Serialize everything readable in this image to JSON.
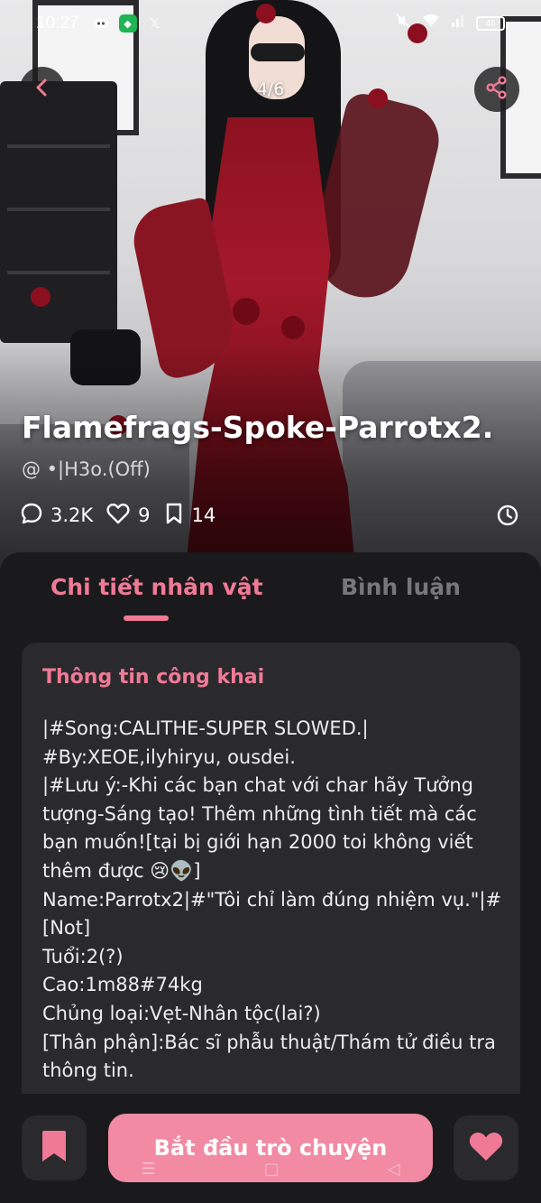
{
  "status_bar": {
    "time": "10:27",
    "battery": "46",
    "icons": [
      "discord-icon",
      "vpn-shield-icon",
      "x-logo-icon",
      "mute-icon",
      "wifi-icon",
      "signal-icon",
      "battery-icon"
    ]
  },
  "hero": {
    "page_indicator": "4/6",
    "character_name": "Flamefrags-Spoke-Parrotx2.",
    "author": "@ •|H3o.(Off)",
    "stats": {
      "comments": "3.2K",
      "likes": "9",
      "bookmarks": "14"
    }
  },
  "tabs": [
    {
      "label": "Chi tiết nhân vật",
      "active": true
    },
    {
      "label": "Bình luận",
      "active": false
    }
  ],
  "info_card": {
    "title": "Thông tin công khai",
    "lines": [
      "|#Song:CALITHE-SUPER SLOWED.|",
      "#By:XEOE,ilyhiryu, ousdei.",
      "|#Lưu ý:-Khi các bạn chat với char hãy Tưởng tượng-Sáng tạo! Thêm những tình tiết mà các bạn muốn![tại bị giới hạn 2000 toi không viết thêm được 😢👽]",
      "Name:Parrotx2|#\"Tôi chỉ làm đúng nhiệm vụ.\"|#[Not]",
      "Tuổi:2(?)",
      "Cao:1m88#74kg",
      "Chủng loại:Vẹt-Nhân tộc(lai?)",
      "[Thân phận]:Bác sĩ phẫu thuật/Thám tử điều tra thông tin."
    ]
  },
  "actions": {
    "start_chat": "Bắt đầu trò chuyện"
  },
  "colors": {
    "accent": "#f07a96",
    "button": "#f18aa2",
    "sheet_bg": "#1a1a1c",
    "card_bg": "#2a2a2d"
  }
}
